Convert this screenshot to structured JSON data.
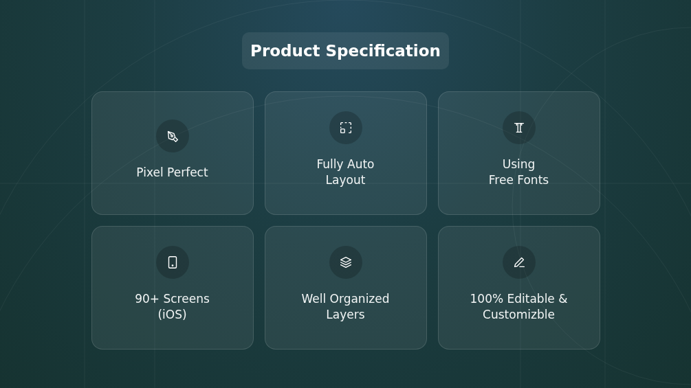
{
  "heading": "Product Specification",
  "features": [
    {
      "kind": "pen-nib",
      "label": "Pixel Perfect"
    },
    {
      "kind": "dashed-frame",
      "label": "Fully Auto\nLayout"
    },
    {
      "kind": "type",
      "label": "Using\nFree Fonts"
    },
    {
      "kind": "tablet",
      "label": "90+ Screens\n(iOS)"
    },
    {
      "kind": "layers",
      "label": "Well Organized\nLayers"
    },
    {
      "kind": "pencil",
      "label": "100% Editable &\nCustomizble"
    }
  ]
}
